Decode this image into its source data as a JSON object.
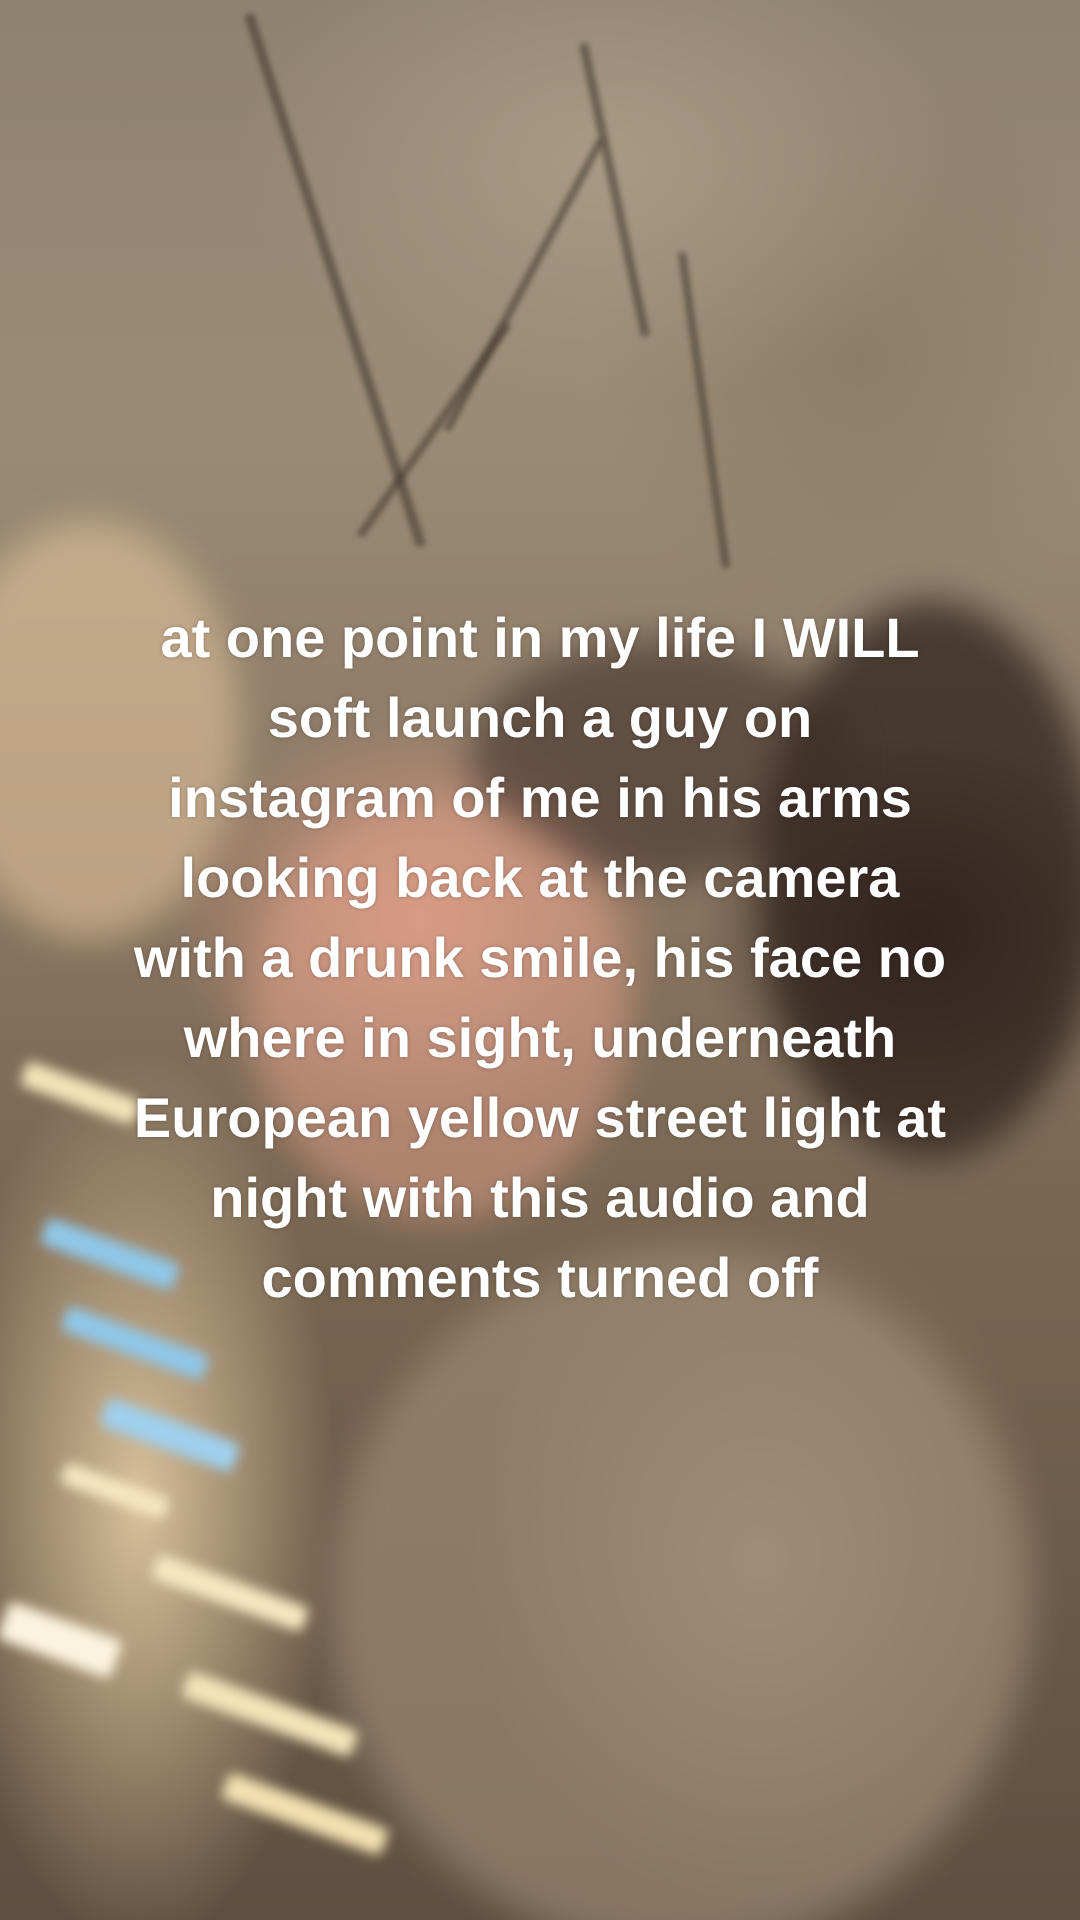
{
  "caption": {
    "lines": [
      "at one point in my life I WILL",
      "soft launch a guy on",
      "instagram of me in his arms",
      "looking back at the camera",
      "with a drunk smile, his face no",
      "where in sight, underneath",
      "European yellow street light at",
      "night with this audio and",
      "comments turned off"
    ]
  },
  "colors": {
    "caption_text": "#ffffff",
    "stone_wall": "#9b8b76",
    "skin_tone": "#d99c86",
    "hair": "#3a2a22",
    "street_lights": "#f3e3b8",
    "blue_lights": "#8fc7e8"
  }
}
